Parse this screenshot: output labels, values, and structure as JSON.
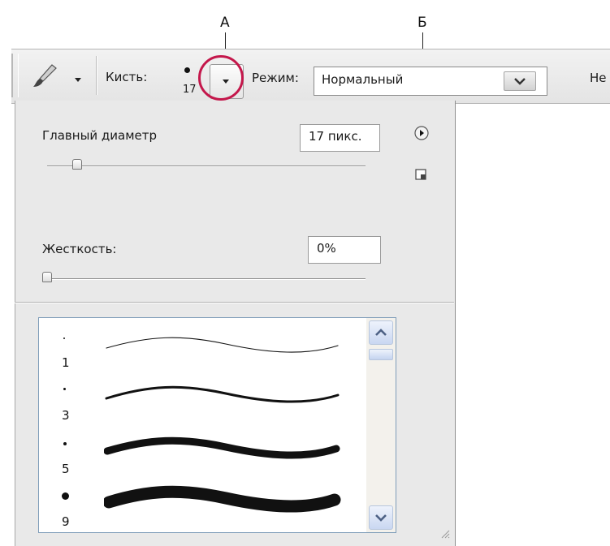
{
  "callouts": {
    "a": "А",
    "b": "Б"
  },
  "option_bar": {
    "brush_label": "Кисть:",
    "brush_size": "17",
    "mode_label": "Режим:",
    "mode_value": "Нормальный",
    "next_label_partial": "Не"
  },
  "panel": {
    "master_diameter_label": "Главный диаметр",
    "master_diameter_value": "17 пикс.",
    "master_diameter_slider": 0.17,
    "hardness_label": "Жесткость:",
    "hardness_value": "0%",
    "hardness_slider": 0.0
  },
  "brush_presets": [
    {
      "size": "1"
    },
    {
      "size": "3"
    },
    {
      "size": "5"
    },
    {
      "size": "9"
    }
  ],
  "colors": {
    "highlight": "#c4174b",
    "list_border": "#7f9db9"
  },
  "icons": [
    "brush-tool-icon",
    "panel-menu-icon",
    "new-preset-icon",
    "scroll-up-icon",
    "scroll-down-icon"
  ]
}
